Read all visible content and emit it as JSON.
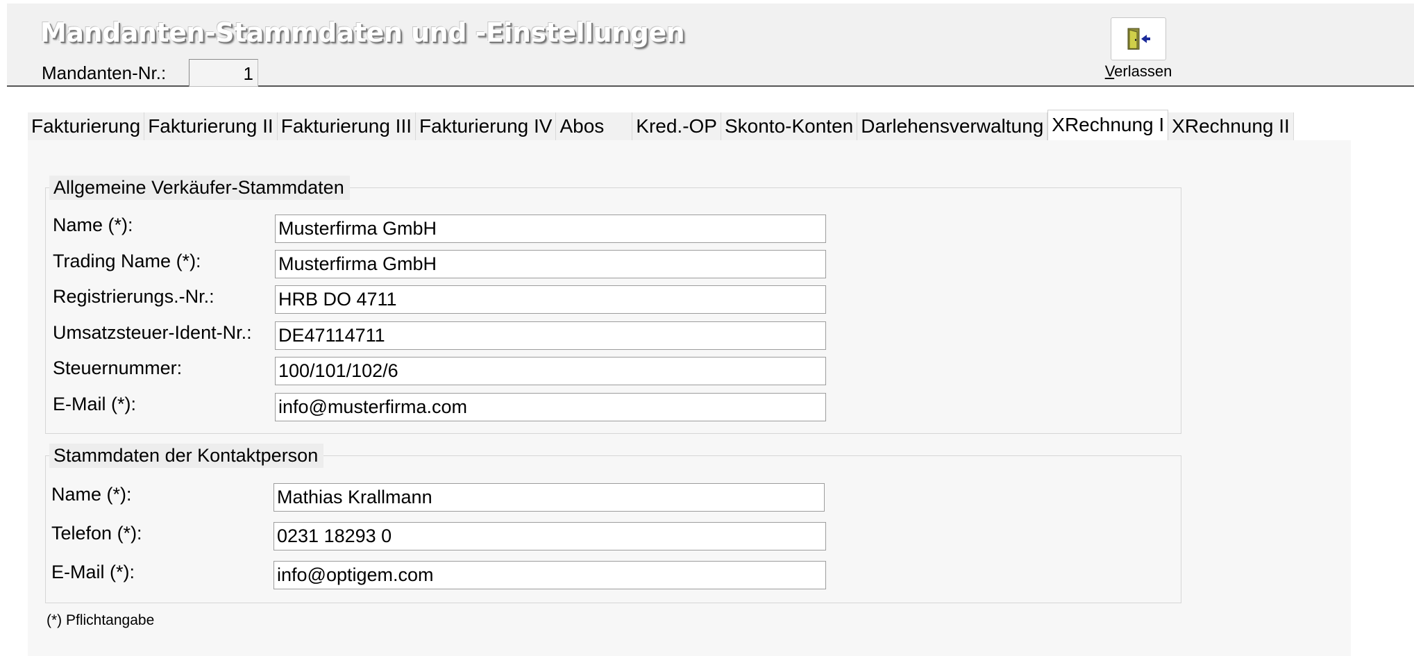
{
  "header": {
    "title": "Mandanten-Stammdaten und -Einstellungen",
    "mandant_label": "Mandanten-Nr.:",
    "mandant_value": "1",
    "exit_button": {
      "mnemonic": "V",
      "rest": "erlassen",
      "icon": "exit-door-icon"
    }
  },
  "tabs": [
    {
      "label": "Fakturierung"
    },
    {
      "label": "Fakturierung II"
    },
    {
      "label": "Fakturierung III"
    },
    {
      "label": "Fakturierung IV"
    },
    {
      "label": "Abos"
    },
    {
      "label": "Kred.-OP"
    },
    {
      "label": "Skonto-Konten"
    },
    {
      "label": "Darlehensverwaltung"
    },
    {
      "label": "XRechnung I",
      "active": true
    },
    {
      "label": "XRechnung II"
    }
  ],
  "seller": {
    "title": "Allgemeine Verkäufer-Stammdaten",
    "fields": [
      {
        "label": "Name (*):",
        "value": "Musterfirma GmbH"
      },
      {
        "label": "Trading Name (*):",
        "value": "Musterfirma GmbH"
      },
      {
        "label": "Registrierungs.-Nr.:",
        "value": "HRB DO 4711"
      },
      {
        "label": "Umsatzsteuer-Ident-Nr.:",
        "value": "DE47114711"
      },
      {
        "label": "Steuernummer:",
        "value": "100/101/102/6"
      },
      {
        "label": "E-Mail (*):",
        "value": "info@musterfirma.com"
      }
    ]
  },
  "contact": {
    "title": "Stammdaten der Kontaktperson",
    "fields": [
      {
        "label": "Name (*):",
        "value": "Mathias Krallmann"
      },
      {
        "label": "Telefon (*):",
        "value": "0231 18293 0"
      },
      {
        "label": "E-Mail (*):",
        "value": "info@optigem.com"
      }
    ]
  },
  "footnote": "(*) Pflichtangabe",
  "colors": {
    "header_bg": "#f1f1f1",
    "panel_bg": "#f7f7f7",
    "field_border": "#9c9c9c"
  }
}
